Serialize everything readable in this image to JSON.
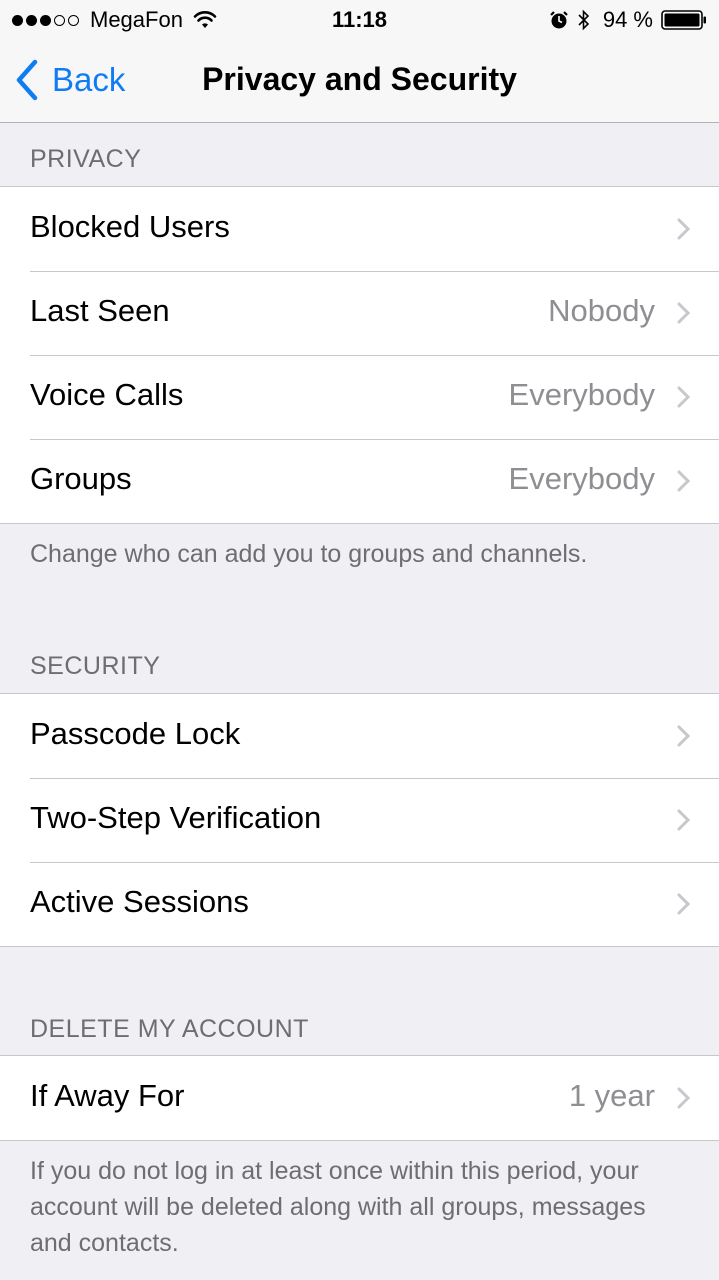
{
  "status_bar": {
    "carrier": "MegaFon",
    "time": "11:18",
    "battery_percent": "94 %",
    "signal_strength": 3,
    "signal_max": 5
  },
  "nav": {
    "back_label": "Back",
    "title": "Privacy and Security"
  },
  "privacy": {
    "header": "PRIVACY",
    "rows": [
      {
        "label": "Blocked Users",
        "value": ""
      },
      {
        "label": "Last Seen",
        "value": "Nobody"
      },
      {
        "label": "Voice Calls",
        "value": "Everybody"
      },
      {
        "label": "Groups",
        "value": "Everybody"
      }
    ],
    "footer": "Change who can add you to groups and channels."
  },
  "security": {
    "header": "SECURITY",
    "rows": [
      {
        "label": "Passcode Lock"
      },
      {
        "label": "Two-Step Verification"
      },
      {
        "label": "Active Sessions"
      }
    ]
  },
  "delete_account": {
    "header": "DELETE MY ACCOUNT",
    "rows": [
      {
        "label": "If Away For",
        "value": "1 year"
      }
    ],
    "footer": "If you do not log in at least once within this period, your account will be deleted along with all groups, messages and contacts."
  },
  "colors": {
    "accent": "#0f7cf6",
    "background": "#efeff4",
    "secondary_text": "#8e8e93"
  },
  "icons": [
    "wifi-icon",
    "alarm-icon",
    "bluetooth-icon",
    "battery-icon",
    "back-chevron-icon",
    "chevron-right-icon"
  ]
}
